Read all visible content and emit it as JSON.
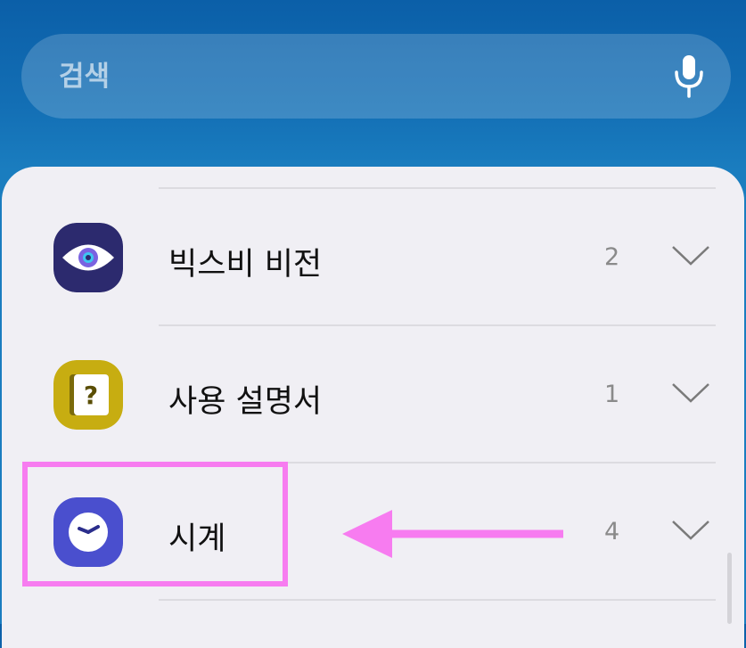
{
  "search": {
    "placeholder": "검색",
    "mic_icon": "microphone-icon"
  },
  "apps": [
    {
      "label": "빅스비 비전",
      "count": "2",
      "icon": "eye-icon",
      "icon_color": "#2c2a6e"
    },
    {
      "label": "사용 설명서",
      "count": "1",
      "icon": "question-book-icon",
      "icon_color": "#c7ad11"
    },
    {
      "label": "시계",
      "count": "4",
      "icon": "clock-icon",
      "icon_color": "#4a4fce"
    }
  ],
  "annotation": {
    "highlight_color": "#f77cf0",
    "arrow_color": "#f77cf0"
  },
  "colors": {
    "header_blue": "#136fb5",
    "panel_bg": "#f0eff4"
  }
}
